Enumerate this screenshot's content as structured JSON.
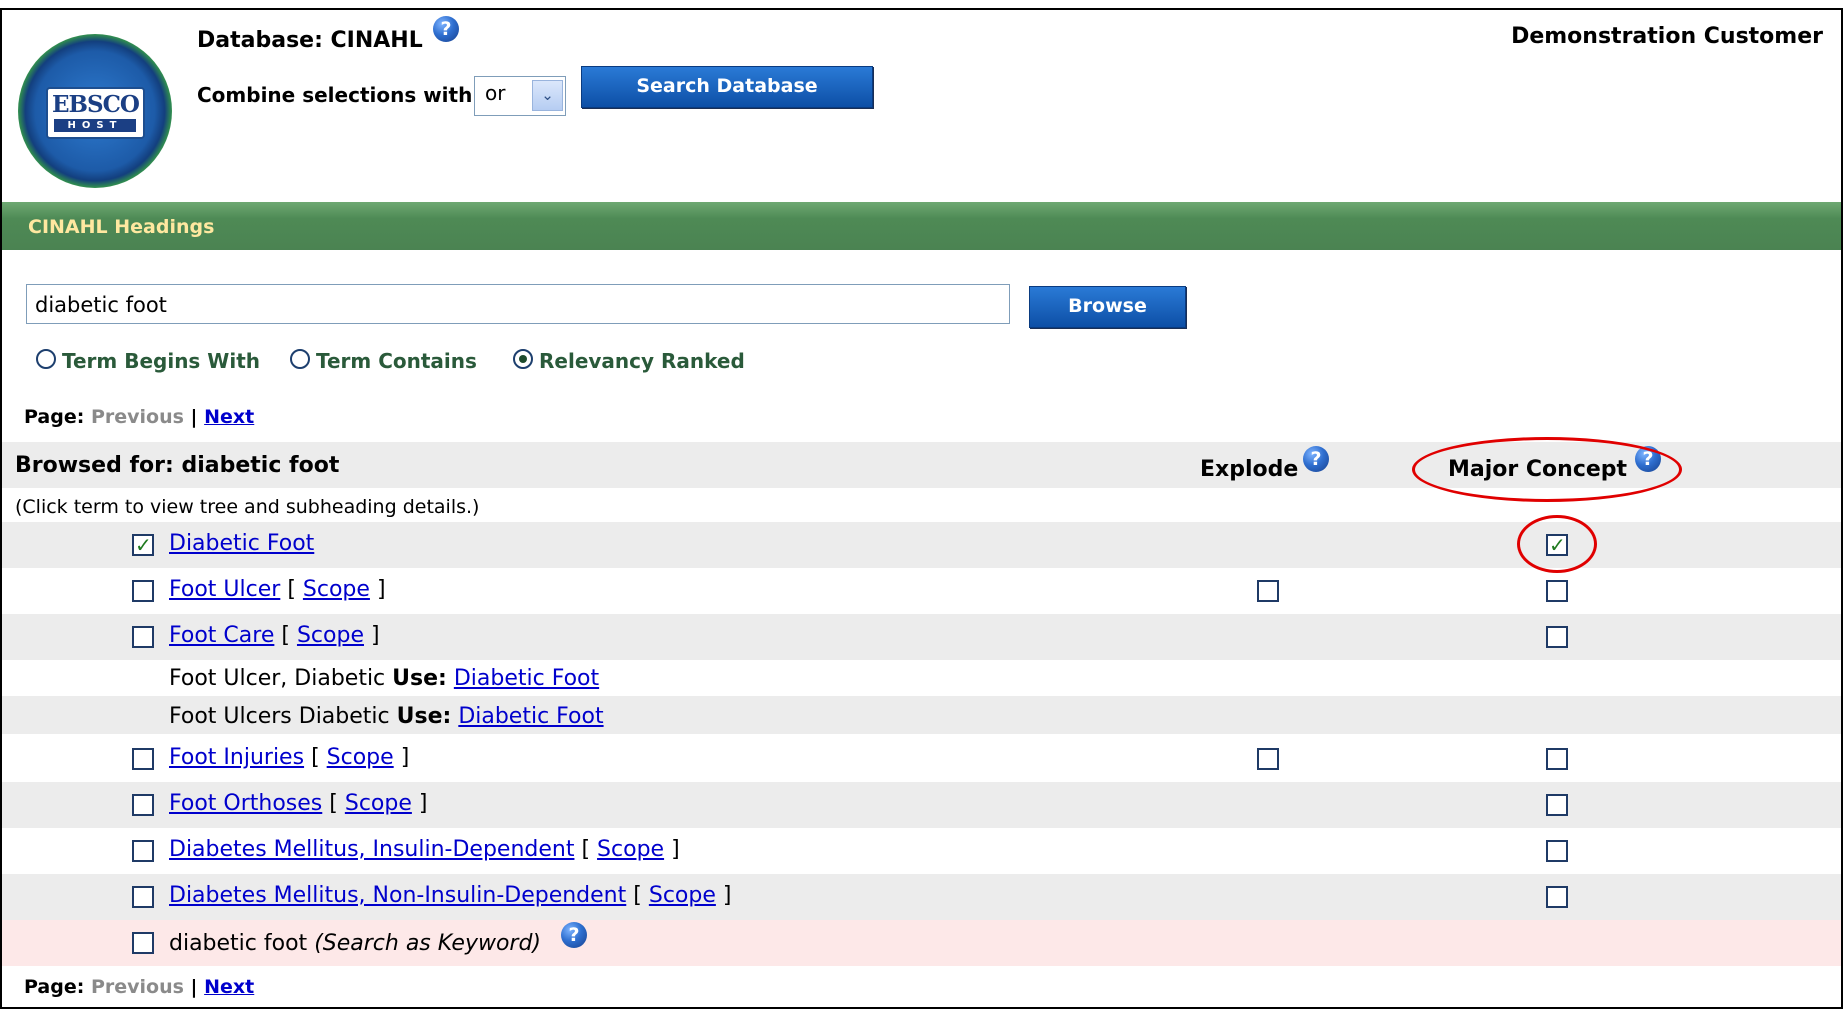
{
  "header": {
    "database_label": "Database: CINAHL",
    "combine_label": "Combine selections with:",
    "combine_value": "or",
    "search_button": "Search Database",
    "customer": "Demonstration Customer",
    "logo_text": "EBSCO",
    "logo_subtext": "HOST"
  },
  "band": {
    "title": "CINAHL  Headings"
  },
  "browse": {
    "input_value": "diabetic foot",
    "button": "Browse",
    "options": [
      {
        "label": "Term Begins With",
        "selected": false
      },
      {
        "label": "Term Contains",
        "selected": false
      },
      {
        "label": "Relevancy Ranked",
        "selected": true
      }
    ]
  },
  "pager": {
    "page_label": "Page:",
    "previous": "Previous",
    "separator": "|",
    "next": "Next"
  },
  "results": {
    "browsed_for": "Browsed for: diabetic foot",
    "explode_header": "Explode",
    "major_header": "Major Concept",
    "hint": "(Click term to view tree and subheading details.)",
    "scope_label": "Scope",
    "bracket_open": "[",
    "bracket_close": "]",
    "use_label": "Use:",
    "rows": [
      {
        "term": "Diabetic Foot",
        "checked": true,
        "major_checked": true
      },
      {
        "term": "Foot Ulcer",
        "checked": false,
        "major_checked": false
      },
      {
        "term": "Foot Care",
        "checked": false,
        "major_checked": false
      },
      {
        "see_term": "Foot Ulcer, Diabetic",
        "use_target": "Diabetic Foot"
      },
      {
        "see_term": "Foot Ulcers Diabetic",
        "use_target": "Diabetic Foot"
      },
      {
        "term": "Foot Injuries",
        "checked": false,
        "major_checked": false
      },
      {
        "term": "Foot Orthoses",
        "checked": false,
        "major_checked": false
      },
      {
        "term": "Diabetes Mellitus, Insulin-Dependent",
        "checked": false,
        "major_checked": false
      },
      {
        "term": "Diabetes Mellitus, Non-Insulin-Dependent",
        "checked": false,
        "major_checked": false
      }
    ],
    "keyword_row": {
      "term": "diabetic foot",
      "suffix": "(Search as Keyword)"
    }
  },
  "icons": {
    "help": "?",
    "check": "✓",
    "dropdown": "⌄"
  },
  "colors": {
    "band_green": "#4e8a55",
    "band_text": "#ffe8a0",
    "link": "#0000cc",
    "highlight_oval": "#e00000",
    "keyword_row_bg": "#fde8e8"
  }
}
